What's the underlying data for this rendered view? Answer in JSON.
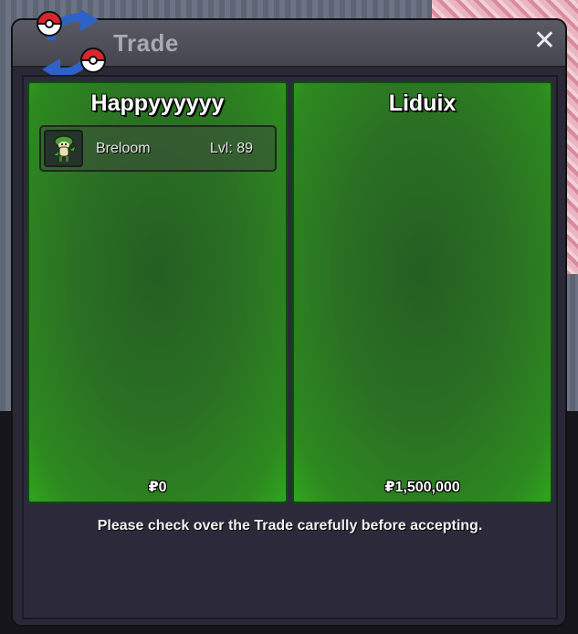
{
  "window": {
    "title": "Trade",
    "close_glyph": "✕"
  },
  "left_panel": {
    "player_name": "Happyyyyyy",
    "items": [
      {
        "name": "Breloom",
        "level": "Lvl: 89",
        "icon": "breloom-sprite-icon"
      }
    ],
    "money": "₽0"
  },
  "right_panel": {
    "player_name": "Liduix",
    "items": [],
    "money": "₽1,500,000"
  },
  "footer": {
    "message": "Please check over the Trade carefully before accepting."
  },
  "colors": {
    "panel_green": "#2d8a1f",
    "window_bg": "#2a2836",
    "title_text": "#a9a9b3"
  }
}
